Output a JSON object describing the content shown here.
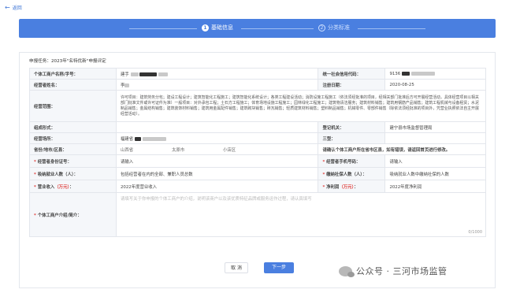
{
  "nav": {
    "back": "返回"
  },
  "steps": [
    {
      "num": "1",
      "label": "基础信息"
    },
    {
      "num": "2",
      "label": "分类标准"
    }
  ],
  "task": "申报任务：2023年\"名特优新\"申报评定",
  "form": {
    "name_label": "个体工商户名称/字号：",
    "name_value": "建手",
    "credit_label": "统一社会信用代码：",
    "credit_value": "9136",
    "operator_label": "经营者姓名：",
    "operator_value": "李",
    "regdate_label": "注册日期：",
    "regdate_value": "2020-08-25",
    "scope_label": "经营范围：",
    "scope_value": "许可项目：建筑劳务分包；建设工程设计；建筑智能化工程施工；建筑智能化系统设计；各类工程建设活动；消防设施工程施工（依法须经批准的项目，经相关部门批准后方可开展经营活动，具体经营项目以相关部门批准文件或许可证件为准）一般项目：对外承包工程；土石方工程施工；体育场地设施工程施工；园林绿化工程施工；建筑物清洁服务；建筑材料销售；建筑用钢筋产品销售；建筑工程机械与设备租赁；水泥制品销售；金属结构销售；建筑装饰材料销售；建筑用金属配件销售；建筑砌块销售；砖瓦销售；轻质建筑材料销售；塑料制品销售；机械零件、零部件销售（除依法须经批准的项目外，凭营业执照依法自主开展经营活动）。",
    "org_label": "组成形式：",
    "org_value": "",
    "regauth_label": "登记机关：",
    "regauth_value": "建宁县市场监督管理局",
    "place_label": "经营场所：",
    "place_value": "福建省",
    "type_label": "三型：",
    "type_value": "",
    "region_label": "省份/地市/区县：",
    "region_prov": "山西省",
    "region_city": "太原市",
    "region_county": "小店区",
    "region_warn": "请确认个体工商户所在省市区县，如有错误，请返回首页进行修改。",
    "idcard_label": "经营者身份证号：",
    "idcard_ph": "请输入",
    "phone_label": "经营者手机号码：",
    "phone_ph": "请输入",
    "employ_label": "吸纳就业人数（人）：",
    "employ_ph": "包括经营者在内的全部、兼职人员总数",
    "social_label": "缴纳社保人数（人）：",
    "social_ph": "吸纳就业人数中缴纳社保的人数",
    "revenue_label": "营业收入",
    "revenue_unit": "（万元）",
    "revenue_ph": "2022年度营业收入",
    "profit_label": "净利润",
    "profit_unit": "（万元）",
    "profit_ph": "2022年度净利润",
    "intro_label": "个体工商户介绍/简介：",
    "intro_ph": "请填写关于你申报的个体工商户的介绍，说明该商户以及该优质特征品牌或服务运作过程，请认真填写",
    "counter": "0/1000"
  },
  "buttons": {
    "cancel": "取 消",
    "next": "下一步"
  },
  "watermark": "公众号 · 三河市场监管"
}
